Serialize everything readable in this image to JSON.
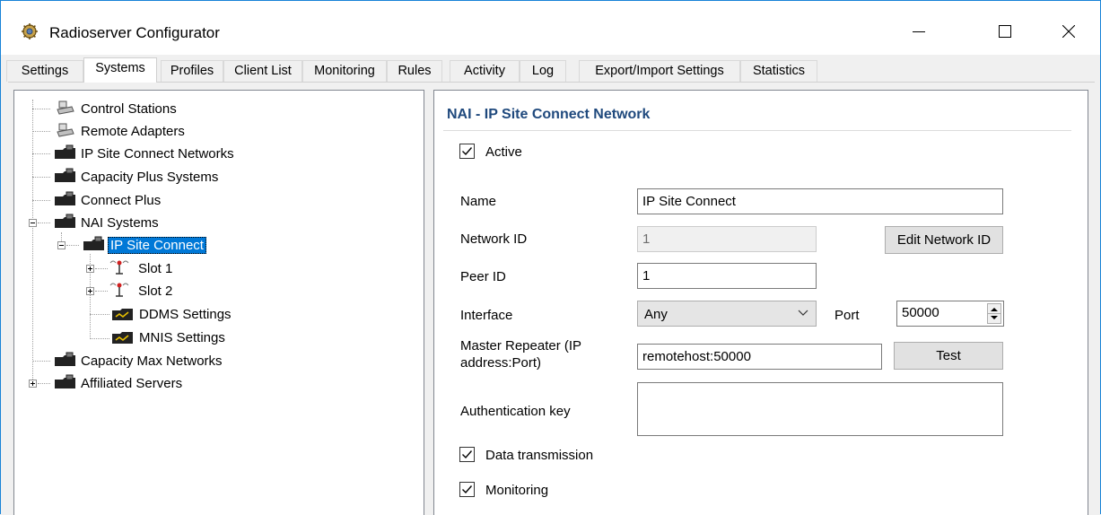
{
  "window": {
    "title": "Radioserver Configurator",
    "icon": "radioserver-app-icon",
    "controls": [
      "minimize-icon",
      "maximize-icon",
      "close-icon"
    ]
  },
  "tabs": [
    {
      "label": "Settings",
      "active": false
    },
    {
      "label": "Systems",
      "active": true
    },
    {
      "label": "Profiles",
      "active": false
    },
    {
      "label": "Client List",
      "active": false
    },
    {
      "label": "Monitoring",
      "active": false
    },
    {
      "label": "Rules",
      "active": false
    },
    {
      "label": "Activity",
      "active": false
    },
    {
      "label": "Log",
      "active": false
    },
    {
      "label": "Export/Import Settings",
      "active": false
    },
    {
      "label": "Statistics",
      "active": false
    }
  ],
  "tree": {
    "items": [
      {
        "label": "Control Stations",
        "icon": "control-station-icon"
      },
      {
        "label": "Remote Adapters",
        "icon": "remote-adapter-icon"
      },
      {
        "label": "IP Site Connect Networks",
        "icon": "network-folder-icon"
      },
      {
        "label": "Capacity Plus Systems",
        "icon": "network-folder-icon"
      },
      {
        "label": "Connect Plus",
        "icon": "network-folder-icon"
      },
      {
        "label": "NAI Systems",
        "icon": "network-folder-icon",
        "expanded": true
      },
      {
        "label": "IP Site Connect",
        "icon": "network-folder-icon",
        "expanded": true,
        "selected": true
      },
      {
        "label": "Slot 1",
        "icon": "antenna-slot-icon"
      },
      {
        "label": "Slot 2",
        "icon": "antenna-slot-icon"
      },
      {
        "label": "DDMS Settings",
        "icon": "ddms-settings-icon"
      },
      {
        "label": "MNIS Settings",
        "icon": "mnis-settings-icon"
      },
      {
        "label": "Capacity Max Networks",
        "icon": "network-folder-icon"
      },
      {
        "label": "Affiliated Servers",
        "icon": "network-folder-icon"
      }
    ]
  },
  "detail": {
    "title": "NAI - IP Site Connect Network",
    "active_label": "Active",
    "active_checked": true,
    "name_label": "Name",
    "name_value": "IP Site Connect",
    "network_id_label": "Network ID",
    "network_id_value": "1",
    "edit_network_id_label": "Edit Network ID",
    "peer_id_label": "Peer ID",
    "peer_id_value": "1",
    "interface_label": "Interface",
    "interface_value": "Any",
    "port_label": "Port",
    "port_value": "50000",
    "master_repeater_label_line1": "Master Repeater (IP",
    "master_repeater_label_line2": "address:Port)",
    "master_repeater_value": "remotehost:50000",
    "test_label": "Test",
    "auth_key_label": "Authentication key",
    "auth_key_value": "",
    "data_transmission_label": "Data transmission",
    "data_transmission_checked": true,
    "monitoring_label": "Monitoring",
    "monitoring_checked": true
  }
}
